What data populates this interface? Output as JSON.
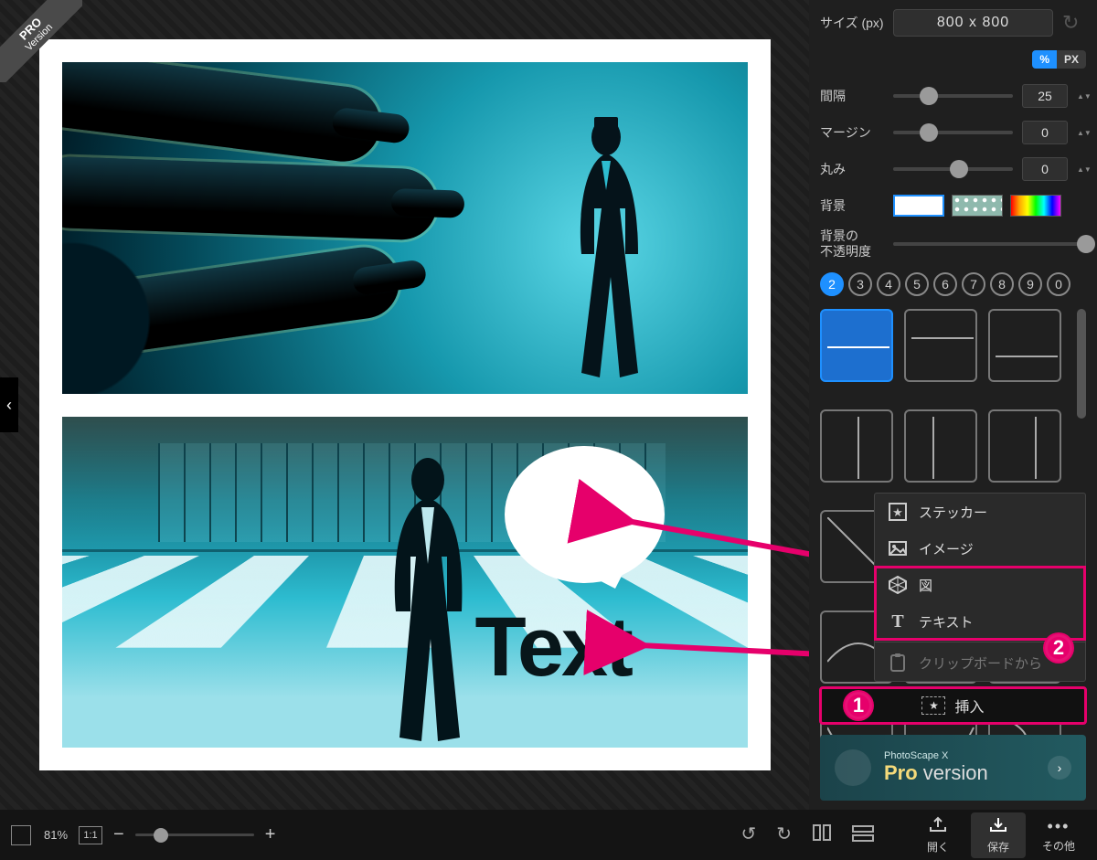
{
  "pro_ribbon": {
    "line1": "PRO",
    "line2": "Version"
  },
  "canvas": {
    "text_overlay": "Text"
  },
  "sidebar": {
    "size_label": "サイズ (px)",
    "size_value": "800 x 800",
    "unit_percent": "%",
    "unit_px": "PX",
    "spacing_label": "間隔",
    "spacing_value": "25",
    "margin_label": "マージン",
    "margin_value": "0",
    "rounding_label": "丸み",
    "rounding_value": "0",
    "bg_label": "背景",
    "opacity_label_l1": "背景の",
    "opacity_label_l2": "不透明度",
    "counts": [
      "2",
      "3",
      "4",
      "5",
      "6",
      "7",
      "8",
      "9",
      "0"
    ],
    "count_active": "2",
    "menu": {
      "sticker": "ステッカー",
      "image": "イメージ",
      "shape": "図",
      "text": "テキスト",
      "clipboard": "クリップボードから"
    },
    "badge2_label": "2",
    "insert_button": "挿入",
    "badge1_label": "1",
    "promo": {
      "app": "PhotoScape X",
      "pro": "Pro",
      "ver": " version"
    }
  },
  "bottom": {
    "zoom_pct": "81%",
    "one_to_one": "1:1",
    "open": "開く",
    "save": "保存",
    "other": "その他"
  }
}
